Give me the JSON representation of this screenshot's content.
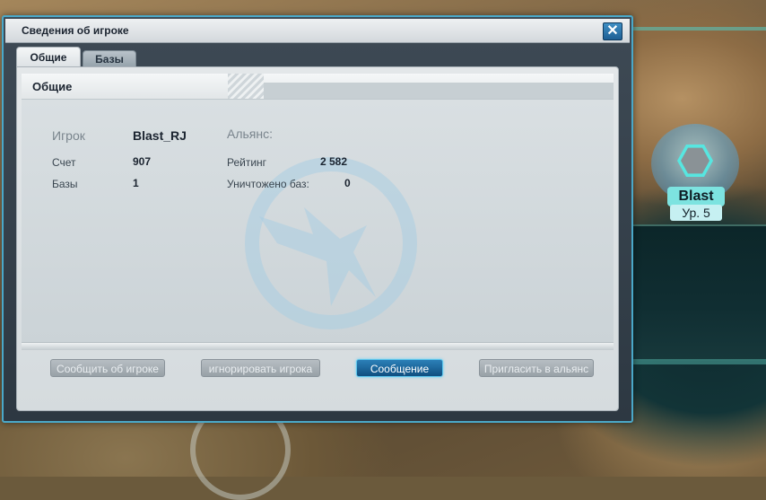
{
  "window": {
    "title": "Сведения об игроке",
    "close_icon": "close-icon"
  },
  "tabs": [
    {
      "label": "Общие",
      "active": true
    },
    {
      "label": "Базы",
      "active": false
    }
  ],
  "section": {
    "title": "Общие"
  },
  "player": {
    "label_player": "Игрок",
    "name": "Blast_RJ",
    "label_score": "Счет",
    "score": "907",
    "label_bases": "Базы",
    "bases": "1",
    "label_alliance": "Альянс:",
    "alliance": "",
    "label_rank": "Рейтинг",
    "rank": "2 582",
    "label_destroyed": "Уничтожено баз:",
    "destroyed": "0"
  },
  "buttons": [
    {
      "label": "Сообщить об игроке",
      "enabled": false
    },
    {
      "label": "игнорировать игрока",
      "enabled": false
    },
    {
      "label": "Сообщение",
      "enabled": true
    },
    {
      "label": "Пригласить в альянс",
      "enabled": false
    }
  ],
  "map_marker": {
    "name": "Blast",
    "level": "Ур. 5"
  },
  "colors": {
    "accent": "#4aa8c8",
    "primary_button": "#0f4f80",
    "marker_label": "#7de3e0"
  }
}
